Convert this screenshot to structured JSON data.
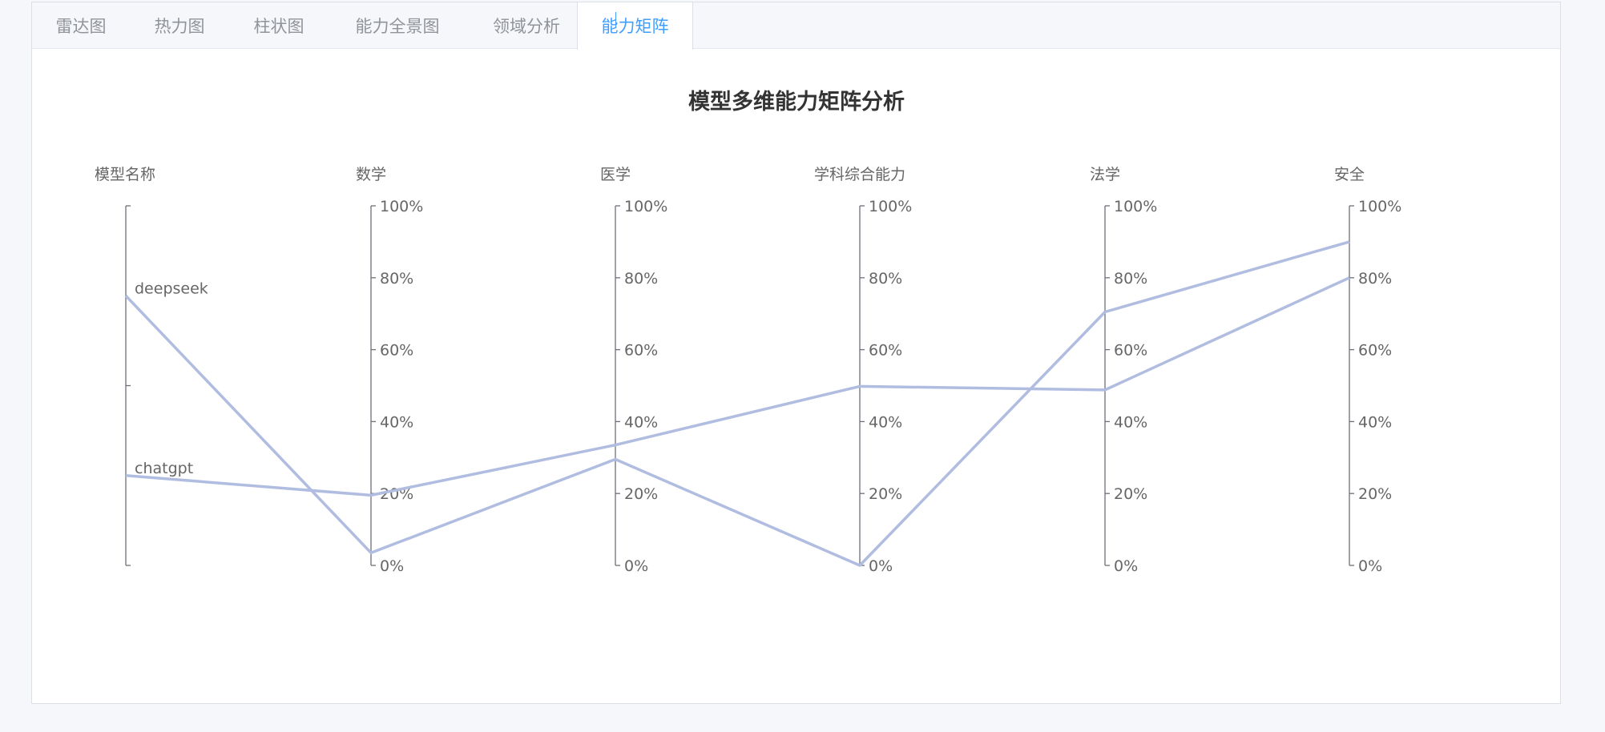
{
  "tabs": [
    {
      "label": "雷达图",
      "active": false
    },
    {
      "label": "热力图",
      "active": false
    },
    {
      "label": "柱状图",
      "active": false
    },
    {
      "label": "能力全景图",
      "active": false
    },
    {
      "label": "领域分析",
      "active": false
    },
    {
      "label": "能力矩阵",
      "active": true
    }
  ],
  "colors": {
    "accent": "#409eff",
    "line": "#b0bde0",
    "axis": "#6e7079",
    "text": "#666666",
    "title": "#333333"
  },
  "chart_data": {
    "type": "parallel",
    "title": "模型多维能力矩阵分析",
    "category_axis": {
      "name": "模型名称",
      "categories": [
        "chatgpt",
        "deepseek"
      ]
    },
    "value_axes": [
      {
        "name": "数学",
        "ticks": [
          "0%",
          "20%",
          "40%",
          "60%",
          "80%",
          "100%"
        ],
        "range": [
          0,
          100
        ]
      },
      {
        "name": "医学",
        "ticks": [
          "0%",
          "20%",
          "40%",
          "60%",
          "80%",
          "100%"
        ],
        "range": [
          0,
          100
        ]
      },
      {
        "name": "学科综合能力",
        "ticks": [
          "0%",
          "20%",
          "40%",
          "60%",
          "80%",
          "100%"
        ],
        "range": [
          0,
          100
        ]
      },
      {
        "name": "法学",
        "ticks": [
          "0%",
          "20%",
          "40%",
          "60%",
          "80%",
          "100%"
        ],
        "range": [
          0,
          100
        ]
      },
      {
        "name": "安全",
        "ticks": [
          "0%",
          "20%",
          "40%",
          "60%",
          "80%",
          "100%"
        ],
        "range": [
          0,
          100
        ]
      }
    ],
    "series": [
      {
        "category": "deepseek",
        "values": [
          3.5,
          29.5,
          0,
          70.5,
          90
        ]
      },
      {
        "category": "chatgpt",
        "values": [
          19.5,
          33.5,
          49.8,
          48.8,
          80
        ]
      }
    ]
  }
}
